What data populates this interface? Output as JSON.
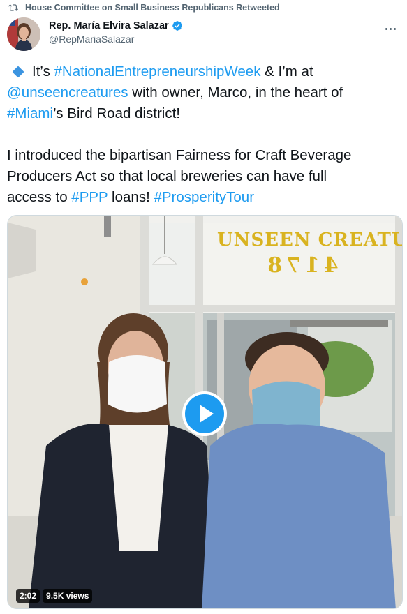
{
  "retweet": {
    "icon": "retweet-icon",
    "text": "House Committee on Small Business Republicans Retweeted"
  },
  "author": {
    "display_name": "Rep. María Elvira Salazar",
    "handle": "@RepMariaSalazar",
    "verified_icon": "verified-badge-icon",
    "more_icon": "more-options-icon"
  },
  "tweet": {
    "line1": {
      "pre": "It’s ",
      "hashtag": "#NationalEntrepreneurshipWeek",
      "post": " & I’m at"
    },
    "line2": {
      "mention": "@unseencreatures",
      "post": " with owner, Marco, in the heart of"
    },
    "line3": {
      "hashtag": "#Miami",
      "post": "’s Bird Road district!"
    },
    "line4": "I introduced the bipartisan Fairness for Craft Beverage",
    "line5": "Producers Act so that local breweries can have full",
    "line6": {
      "pre": "access to ",
      "hashtag1": "#PPP",
      "mid": " loans! ",
      "hashtag2": "#ProsperityTour"
    }
  },
  "video": {
    "window_sign_line1": "UNSEEN CREATURES",
    "window_sign_line2": "4178",
    "duration": "2:02",
    "views": "9.5K views",
    "play_icon": "play-icon"
  },
  "colors": {
    "link": "#1d9bf0",
    "text": "#0f1419",
    "secondary": "#536471",
    "accent_diamond": "#3b94e0"
  }
}
